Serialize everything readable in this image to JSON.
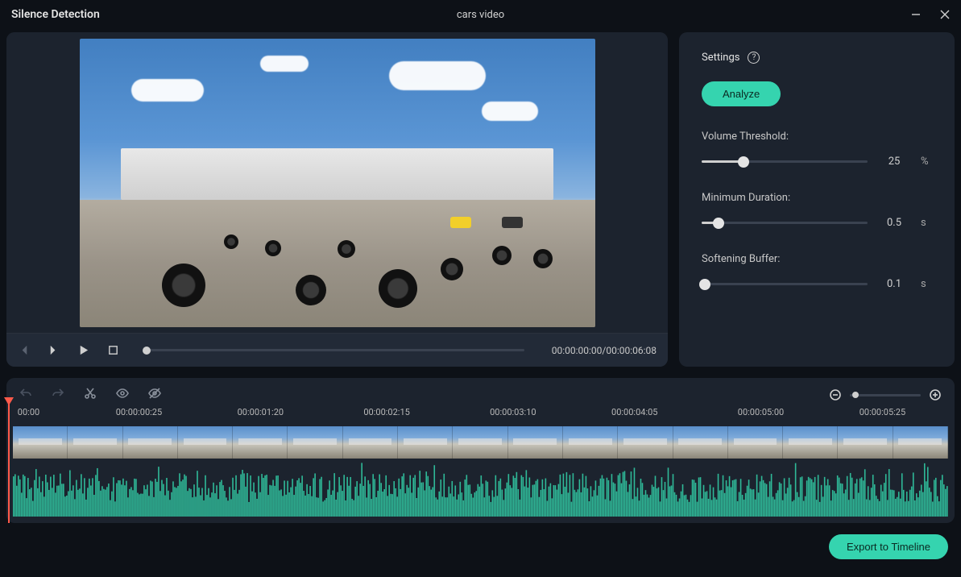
{
  "titlebar": {
    "title": "Silence Detection",
    "document": "cars video"
  },
  "player": {
    "time": "00:00:00:00/00:00:06:08"
  },
  "settings": {
    "header": "Settings",
    "analyze_label": "Analyze",
    "volume_threshold": {
      "label": "Volume Threshold:",
      "value": "25",
      "unit": "%",
      "percent": 25
    },
    "minimum_duration": {
      "label": "Minimum Duration:",
      "value": "0.5",
      "unit": "s",
      "percent": 10
    },
    "softening_buffer": {
      "label": "Softening Buffer:",
      "value": "0.1",
      "unit": "s",
      "percent": 2
    }
  },
  "timeline": {
    "ticks": [
      "00:00",
      "00:00:00:25",
      "00:00:01:20",
      "00:00:02:15",
      "00:00:03:10",
      "00:00:04:05",
      "00:00:05:00",
      "00:00:05:25"
    ]
  },
  "footer": {
    "export_label": "Export to Timeline"
  }
}
